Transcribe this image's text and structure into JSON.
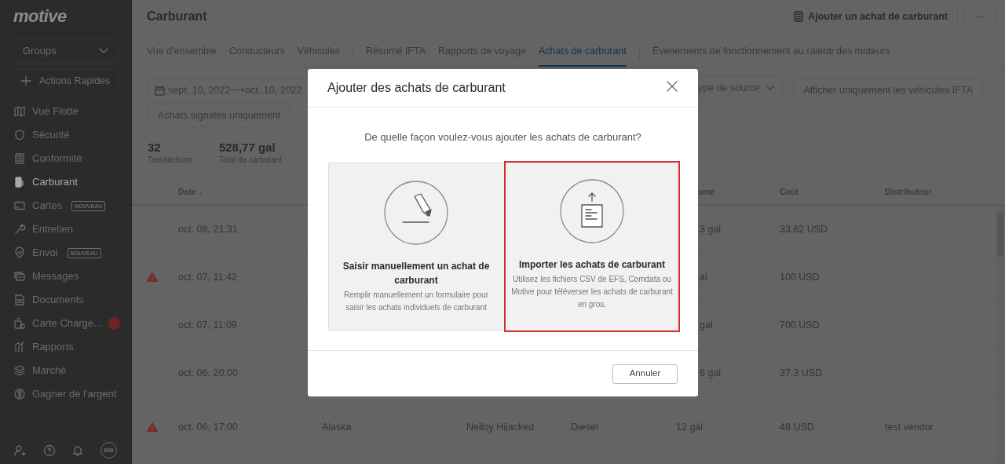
{
  "sidebar": {
    "logo": "motive",
    "groups": "Groups",
    "quick_actions": "Actions Rapides",
    "items": [
      {
        "label": "Vue Flotte",
        "selected": false
      },
      {
        "label": "Sécurité",
        "selected": false
      },
      {
        "label": "Conformité",
        "selected": false
      },
      {
        "label": "Carburant",
        "selected": true
      },
      {
        "label": "Cartes",
        "selected": false,
        "badge": "NOUVEAU"
      },
      {
        "label": "Entretien",
        "selected": false
      },
      {
        "label": "Envoi",
        "selected": false,
        "badge": "NOUVEAU"
      },
      {
        "label": "Messages",
        "selected": false
      },
      {
        "label": "Documents",
        "selected": false
      },
      {
        "label": "Carte Charge...",
        "selected": false,
        "dot": true
      },
      {
        "label": "Rapports",
        "selected": false
      },
      {
        "label": "Marché",
        "selected": false
      },
      {
        "label": "Gagner de l'argent",
        "selected": false
      }
    ],
    "avatar": "MB"
  },
  "header": {
    "title": "Carburant",
    "add_button": "Ajouter un achat de carburant",
    "more_button": "···"
  },
  "tabs": [
    {
      "label": "Vue d'ensemble",
      "selected": false
    },
    {
      "label": "Conducteurs",
      "selected": false
    },
    {
      "label": "Véhicules",
      "selected": false
    },
    {
      "label": "Résumé IFTA",
      "selected": false
    },
    {
      "label": "Rapports de voyage",
      "selected": false
    },
    {
      "label": "Achats de carburant",
      "selected": true
    },
    {
      "label": "Événements de fonctionnement au ralenti des moteurs",
      "selected": false
    }
  ],
  "filters": {
    "date_range": "sept. 10, 2022⟶oct. 10, 2022",
    "source_type": "ype de source",
    "ifta_only": "Afficher uniquement les véhicules IFTA",
    "flagged_only": "Achats signalés uniquement"
  },
  "stats": [
    {
      "value": "32",
      "label": "Transactions"
    },
    {
      "value": "528,77 gal",
      "label": "Total du carburant"
    }
  ],
  "table": {
    "columns": {
      "date": "Date ↓",
      "volume": "ume",
      "cost": "Coût",
      "distributor": "Distributeur"
    },
    "rows": [
      {
        "kind": "covered",
        "flagged": false,
        "date": "oct. 08, 21:31",
        "volume": "3 gal",
        "cost": "33,62 USD"
      },
      {
        "kind": "covered",
        "flagged": true,
        "date": "oct. 07, 11:42",
        "volume": "al",
        "cost": "100 USD"
      },
      {
        "kind": "covered",
        "flagged": false,
        "date": "oct. 07, 11:09",
        "volume": "gal",
        "cost": "700 USD"
      },
      {
        "kind": "covered",
        "flagged": false,
        "date": "oct. 06, 20:00",
        "volume": "6 gal",
        "cost": "37,3 USD"
      },
      {
        "kind": "full",
        "flagged": true,
        "date": "oct. 06, 17:00",
        "location": "Alaska",
        "driver": "Neiloy Hijacked",
        "fuel": "Diesel",
        "volume": "12 gal",
        "cost": "48 USD",
        "distributor": "test vendor"
      }
    ]
  },
  "modal": {
    "title": "Ajouter des achats de carburant",
    "question": "De quelle façon voulez-vous ajouter les achats de carburant?",
    "options": [
      {
        "kind": "manual",
        "title": "Saisir manuellement un achat de carburant",
        "description": "Remplir manuellement un formulaire pour saisir les achats individuels de carburant",
        "selected": false
      },
      {
        "kind": "import",
        "title": "Importer les achats de carburant",
        "description": "Utilisez les fichiers CSV de EFS, Comdata ou Motive pour téléverser les achats de carburant en gros.",
        "selected": true
      }
    ],
    "cancel": "Annuler"
  }
}
